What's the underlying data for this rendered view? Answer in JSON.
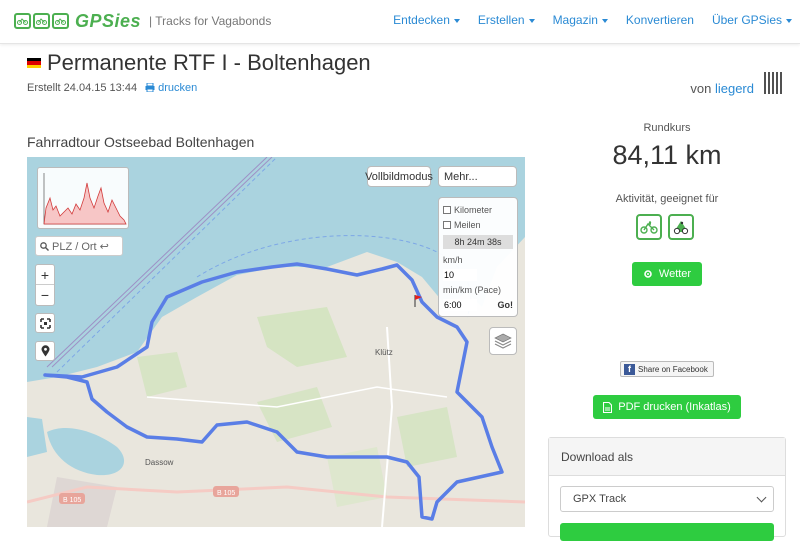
{
  "brand": {
    "name": "GPSies",
    "tagline": "| Tracks for Vagabonds",
    "accent": "#4caf50",
    "link_color": "#2a8ad4"
  },
  "nav": {
    "items": [
      {
        "label": "Entdecken",
        "dropdown": true
      },
      {
        "label": "Erstellen",
        "dropdown": true
      },
      {
        "label": "Magazin",
        "dropdown": true
      },
      {
        "label": "Konvertieren",
        "dropdown": false
      },
      {
        "label": "Über GPSies",
        "dropdown": true
      }
    ]
  },
  "header": {
    "title": "Permanente RTF I - Boltenhagen",
    "created": "Erstellt 24.04.15 13:44",
    "print_label": "drucken",
    "author_prefix": "von",
    "author": "liegerd"
  },
  "track": {
    "description": "Fahrradtour Ostseebad Boltenhagen"
  },
  "map": {
    "search_placeholder": "PLZ / Ort ↩",
    "fullscreen_label": "Vollbildmodus",
    "more_label": "Mehr...",
    "zoom_in": "+",
    "zoom_out": "−",
    "pace": {
      "km_label": "Kilometer",
      "miles_label": "Meilen",
      "time": "8h 24m 38s",
      "speed_unit": "km/h",
      "speed_value": "10",
      "pace_unit": "min/km (Pace)",
      "pace_value": "6:00",
      "go_label": "Go!"
    },
    "place_labels": [
      "Klütz",
      "Dassow",
      "B 105",
      "B 105"
    ]
  },
  "stats": {
    "route_type": "Rundkurs",
    "distance": "84,11 km",
    "activity_label": "Aktivität, geeignet für"
  },
  "buttons": {
    "weather": "Wetter",
    "facebook": "Share on Facebook",
    "pdf": "PDF drucken (Inkatlas)"
  },
  "download": {
    "heading": "Download als",
    "selected_format": "GPX Track"
  },
  "icons": {
    "logo": "bicycle-logo-icon",
    "print": "printer-icon",
    "qr": "qr-code-icon",
    "search": "search-icon",
    "fullscreen": "expand-icon",
    "location": "map-pin-icon",
    "layers": "layers-icon",
    "weather": "gear-icon",
    "pdf": "pdf-icon",
    "bike": "bicycle-icon",
    "mtb": "mountain-bike-icon"
  }
}
